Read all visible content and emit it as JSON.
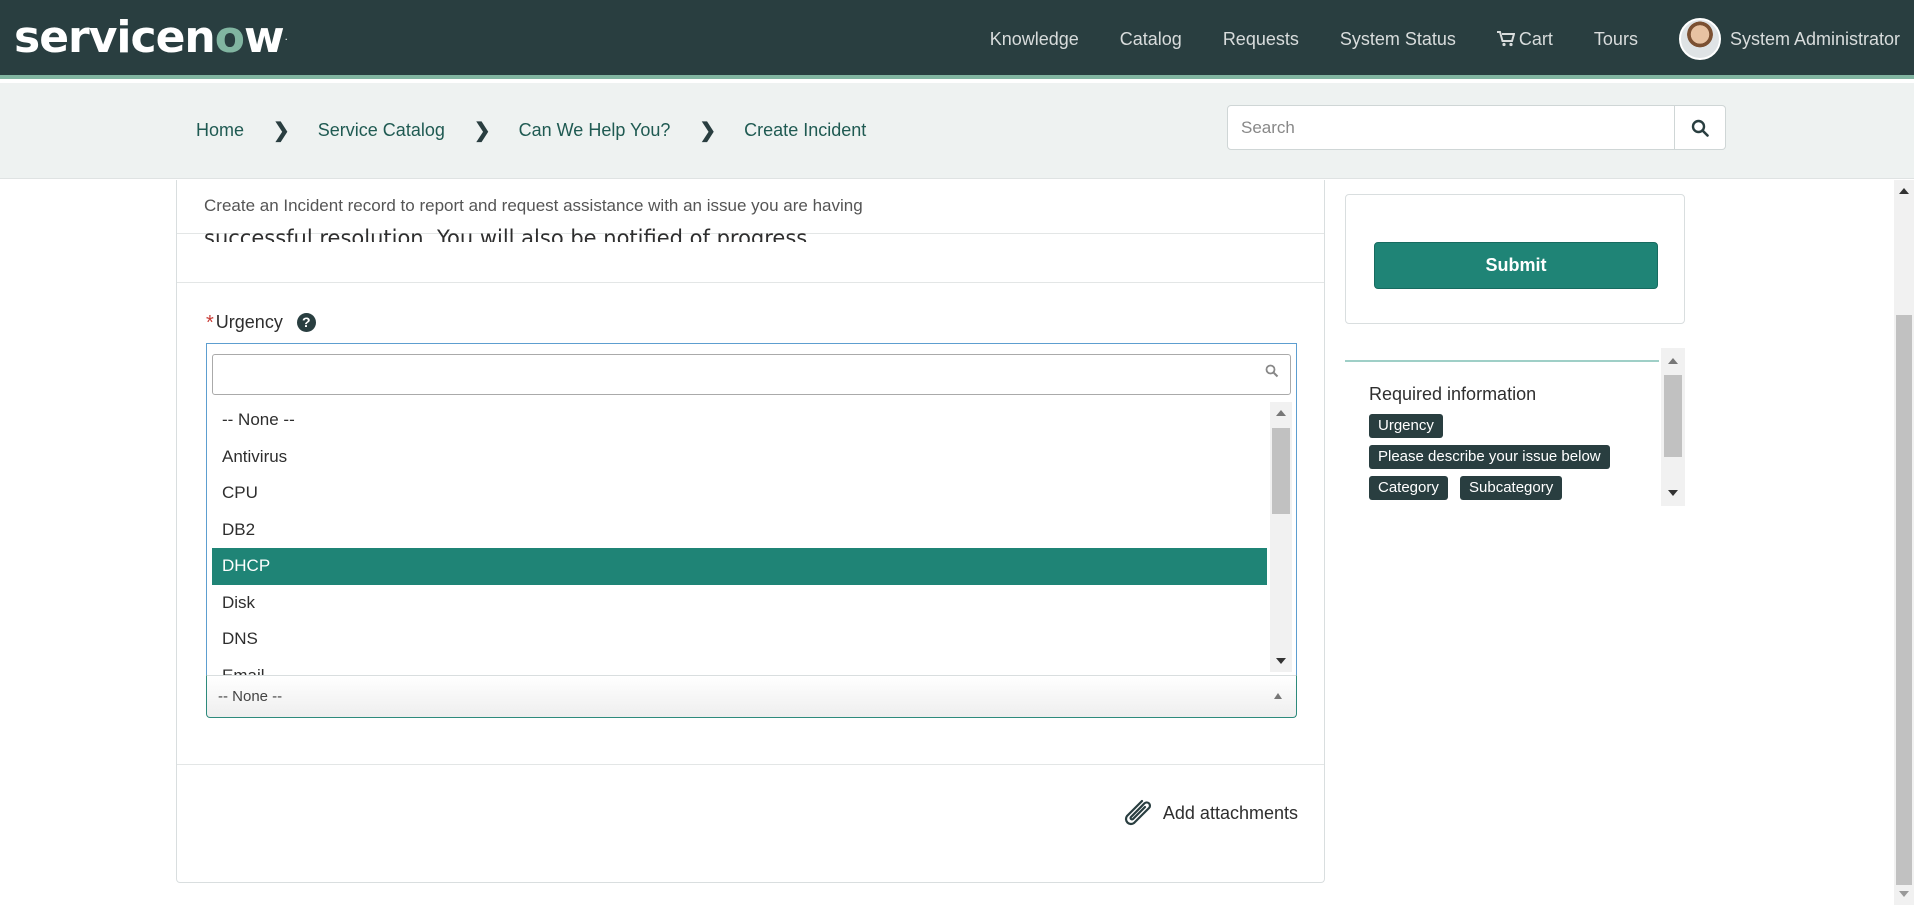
{
  "header": {
    "logo_prefix": "servicen",
    "logo_o": "o",
    "logo_suffix": "w",
    "logo_tm": ".",
    "nav": {
      "knowledge": "Knowledge",
      "catalog": "Catalog",
      "requests": "Requests",
      "system_status": "System Status",
      "cart": "Cart",
      "tours": "Tours"
    },
    "user_name": "System Administrator"
  },
  "breadcrumb": {
    "items": [
      "Home",
      "Service Catalog",
      "Can We Help You?",
      "Create Incident"
    ]
  },
  "search": {
    "placeholder": "Search"
  },
  "form": {
    "intro": "Create an Incident record to report and request assistance with an issue you are having",
    "intro_partial": "successful resolution. You will also be notified of progress.",
    "required_marker": "*",
    "urgency_label": "Urgency",
    "help_glyph": "?",
    "dropdown": {
      "search_value": "",
      "options": [
        "-- None --",
        "Antivirus",
        "CPU",
        "DB2",
        "DHCP",
        "Disk",
        "DNS",
        "Email"
      ],
      "highlighted": "DHCP"
    },
    "select_value": "-- None --",
    "add_attachments": "Add attachments"
  },
  "sidebar": {
    "submit_label": "Submit",
    "required_title": "Required information",
    "required_tags": [
      "Urgency",
      "Please describe your issue below",
      "Category",
      "Subcategory"
    ]
  },
  "colors": {
    "header_bg": "#293e40",
    "accent": "#1f8476",
    "link": "#1f5a52"
  }
}
